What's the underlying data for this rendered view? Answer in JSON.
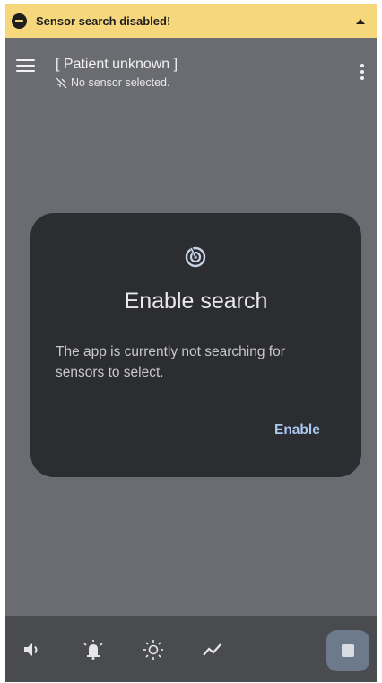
{
  "banner": {
    "text": "Sensor search disabled!",
    "icon": "minus-circle-icon",
    "toggle_icon": "caret-up-icon",
    "color": "#f6d77c"
  },
  "appbar": {
    "title": "[ Patient unknown ]",
    "subtitle": "No sensor selected.",
    "subtitle_icon": "sensor-off-icon",
    "menu_icon": "hamburger-menu-icon",
    "more_icon": "more-vertical-icon"
  },
  "dialog": {
    "icon": "radar-search-icon",
    "title": "Enable search",
    "body": "The app is currently not searching for sensors to select.",
    "action_label": "Enable",
    "action_color": "#a9c7ef"
  },
  "bottombar": {
    "icons": [
      "volume-icon",
      "alarm-bell-icon",
      "brightness-icon",
      "trend-icon"
    ],
    "stop_icon": "stop-icon"
  }
}
